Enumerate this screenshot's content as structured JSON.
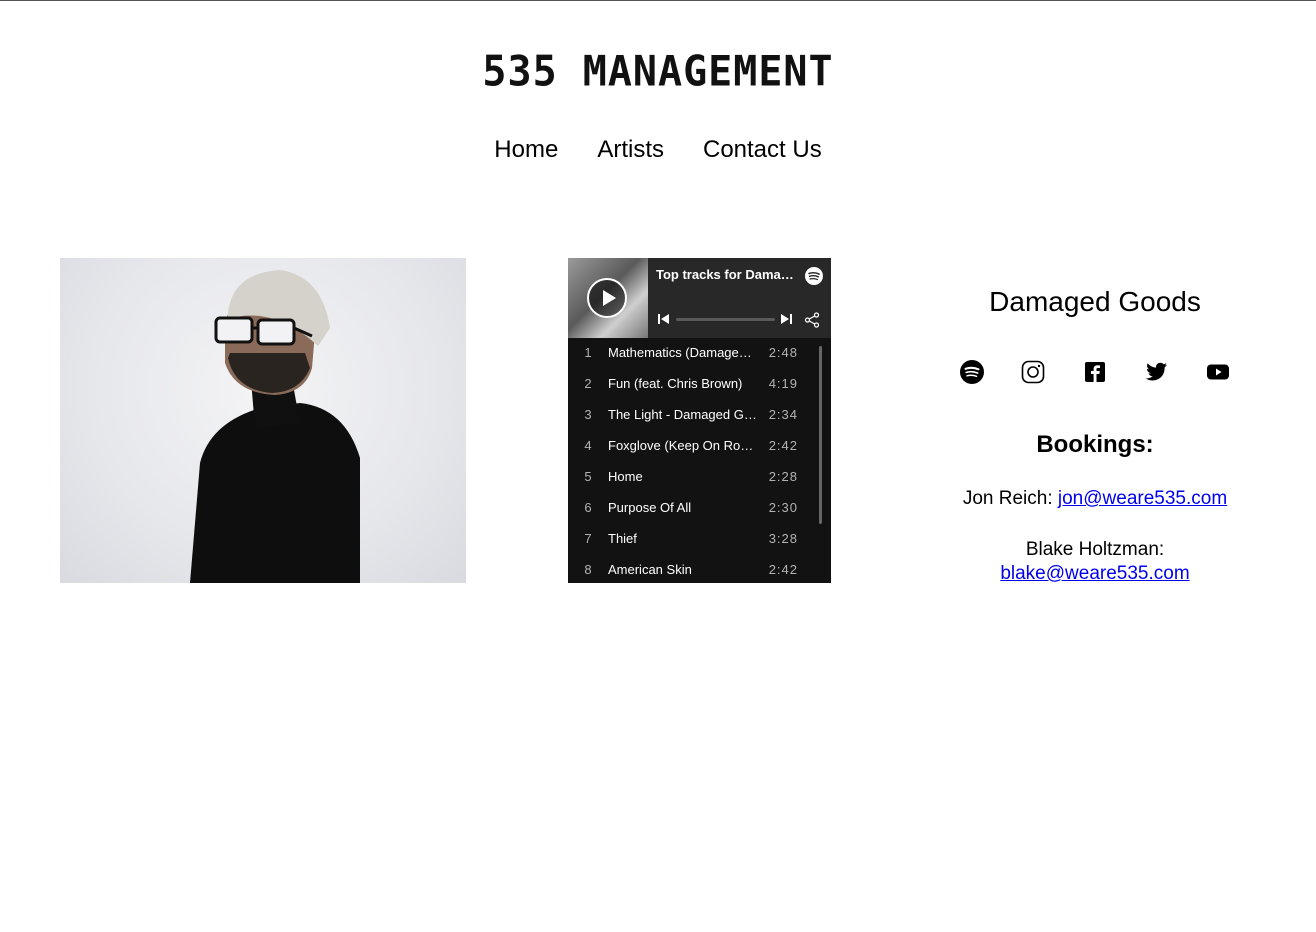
{
  "header": {
    "logo_text": "535 MANAGEMENT"
  },
  "nav": {
    "items": [
      {
        "label": "Home"
      },
      {
        "label": "Artists"
      },
      {
        "label": "Contact Us"
      }
    ]
  },
  "player": {
    "title": "Top tracks for Damaged Goods",
    "tracks": [
      {
        "num": "1",
        "name": "Mathematics (Damaged Goods Remix)",
        "duration": "2:48"
      },
      {
        "num": "2",
        "name": "Fun (feat. Chris Brown)",
        "duration": "4:19"
      },
      {
        "num": "3",
        "name": "The Light - Damaged Goods Remix",
        "duration": "2:34"
      },
      {
        "num": "4",
        "name": "Foxglove (Keep On Rocking)",
        "duration": "2:42"
      },
      {
        "num": "5",
        "name": "Home",
        "duration": "2:28"
      },
      {
        "num": "6",
        "name": "Purpose Of All",
        "duration": "2:30"
      },
      {
        "num": "7",
        "name": "Thief",
        "duration": "3:28"
      },
      {
        "num": "8",
        "name": "American Skin",
        "duration": "2:42"
      }
    ]
  },
  "artist": {
    "name": "Damaged Goods",
    "socials": [
      "spotify-icon",
      "instagram-icon",
      "facebook-icon",
      "twitter-icon",
      "youtube-icon"
    ]
  },
  "bookings": {
    "title": "Bookings:",
    "contact1_label": "Jon Reich:",
    "contact1_email": "jon@weare535.com",
    "contact2_label": "Blake Holtzman:",
    "contact2_email": "blake@weare535.com"
  },
  "colors": {
    "player_bg": "#121212",
    "player_header": "#282828",
    "link": "#0000ee"
  }
}
